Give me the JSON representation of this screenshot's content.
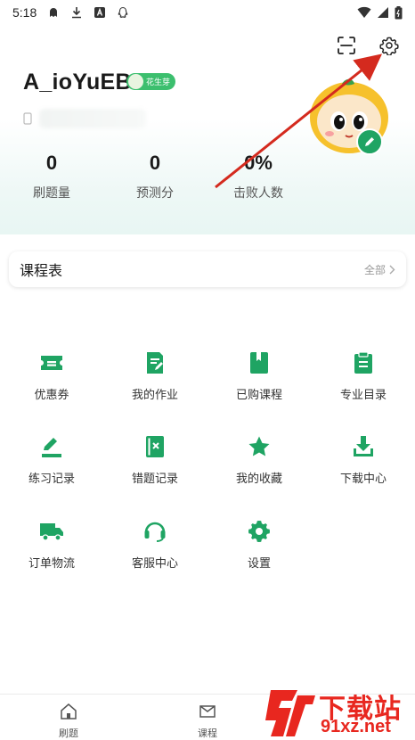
{
  "status_bar": {
    "time": "5:18"
  },
  "profile": {
    "username": "A_ioYuEB",
    "level_badge": "花生芽"
  },
  "stats": [
    {
      "value": "0",
      "label": "刷题量"
    },
    {
      "value": "0",
      "label": "预测分"
    },
    {
      "value": "0%",
      "label": "击败人数"
    }
  ],
  "schedule": {
    "title": "课程表",
    "more_label": "全部"
  },
  "grid": [
    {
      "label": "优惠券",
      "icon": "coupon-icon"
    },
    {
      "label": "我的作业",
      "icon": "homework-icon"
    },
    {
      "label": "已购课程",
      "icon": "purchased-course-icon"
    },
    {
      "label": "专业目录",
      "icon": "catalog-icon"
    },
    {
      "label": "练习记录",
      "icon": "practice-record-icon"
    },
    {
      "label": "错题记录",
      "icon": "wrong-record-icon"
    },
    {
      "label": "我的收藏",
      "icon": "star-icon"
    },
    {
      "label": "下载中心",
      "icon": "download-icon"
    },
    {
      "label": "订单物流",
      "icon": "truck-icon"
    },
    {
      "label": "客服中心",
      "icon": "headset-icon"
    },
    {
      "label": "设置",
      "icon": "gear-icon"
    }
  ],
  "bottom_nav": [
    {
      "label": "刷题",
      "icon": "home-icon"
    },
    {
      "label": "课程",
      "icon": "course-icon"
    }
  ],
  "watermark": {
    "text": "下载站",
    "sub": "91xz.net",
    "logo": "9f"
  },
  "colors": {
    "accent": "#1fa463",
    "arrow": "#d42a1e",
    "watermark": "#e8271f"
  }
}
